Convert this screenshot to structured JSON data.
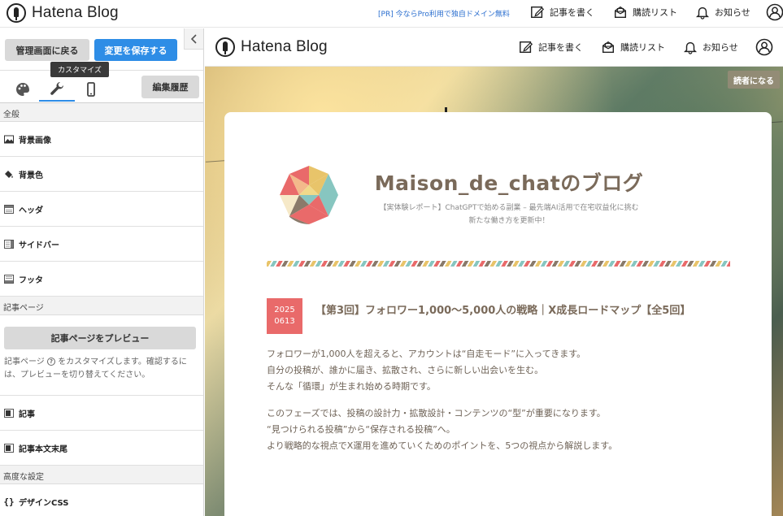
{
  "topbar": {
    "logo_text": "Hatena Blog",
    "pr_link": "[PR] 今ならPro利用で独自ドメイン無料",
    "nav": [
      {
        "label": "記事を書く",
        "icon": "edit-icon"
      },
      {
        "label": "購読リスト",
        "icon": "subscribe-icon"
      },
      {
        "label": "お知らせ",
        "icon": "bell-icon"
      }
    ],
    "avatar_icon": "user-icon"
  },
  "sidebar": {
    "back_label": "管理画面に戻る",
    "save_label": "変更を保存する",
    "tooltip": "カスタマイズ",
    "tabs": [
      {
        "icon": "palette-icon"
      },
      {
        "icon": "wrench-icon"
      },
      {
        "icon": "smartphone-icon"
      }
    ],
    "history_label": "編集履歴",
    "section_general": "全般",
    "general_items": [
      {
        "label": "背景画像",
        "icon": "image-icon"
      },
      {
        "label": "背景色",
        "icon": "paint-bucket-icon"
      },
      {
        "label": "ヘッダ",
        "icon": "layout-icon"
      },
      {
        "label": "サイドバー",
        "icon": "layout-icon"
      },
      {
        "label": "フッタ",
        "icon": "layout-icon"
      }
    ],
    "section_article": "記事ページ",
    "preview_button": "記事ページをプレビュー",
    "preview_desc_before": "記事ページ",
    "preview_desc_after": "をカスタマイズします。確認するには、プレビューを切り替えてください。",
    "article_items": [
      {
        "label": "記事",
        "icon": "article-icon"
      },
      {
        "label": "記事本文末尾",
        "icon": "article-icon"
      }
    ],
    "section_advanced": "高度な設定",
    "advanced_items": [
      {
        "label": "デザインCSS",
        "icon": "braces-icon"
      }
    ]
  },
  "preview": {
    "logo_text": "Hatena Blog",
    "nav": [
      {
        "label": "記事を書く",
        "icon": "edit-icon"
      },
      {
        "label": "購読リスト",
        "icon": "subscribe-icon"
      },
      {
        "label": "お知らせ",
        "icon": "bell-icon"
      }
    ],
    "reader_button": "読者になる",
    "blog_title": "Maison_de_chatのブログ",
    "blog_desc_line1": "【実体験レポート】ChatGPTで始める副業 – 最先端AI活用で在宅収益化に挑む",
    "blog_desc_line2": "新たな働き方を更新中！",
    "date_year": "2025",
    "date_md": "0613",
    "post_title": "【第3回】フォロワー1,000〜5,000人の戦略｜X成長ロードマップ【全5回】",
    "paragraph1": [
      "フォロワーが1,000人を超えると、アカウントは“自走モード”に入ってきます。",
      "自分の投稿が、誰かに届き、拡散され、さらに新しい出会いを生む。",
      "そんな「循環」が生まれ始める時期です。"
    ],
    "paragraph2": [
      "このフェーズでは、投稿の設計力・拡散設計・コンテンツの“型”が重要になります。",
      "“見つけられる投稿”から“保存される投稿”へ。",
      "より戦略的な視点でX運用を進めていくためのポイントを、5つの視点から解説します。"
    ]
  },
  "colors": {
    "accent_blue": "#2e8de6",
    "date_badge": "#e96a6a",
    "title_brown": "#7a6a5a"
  }
}
